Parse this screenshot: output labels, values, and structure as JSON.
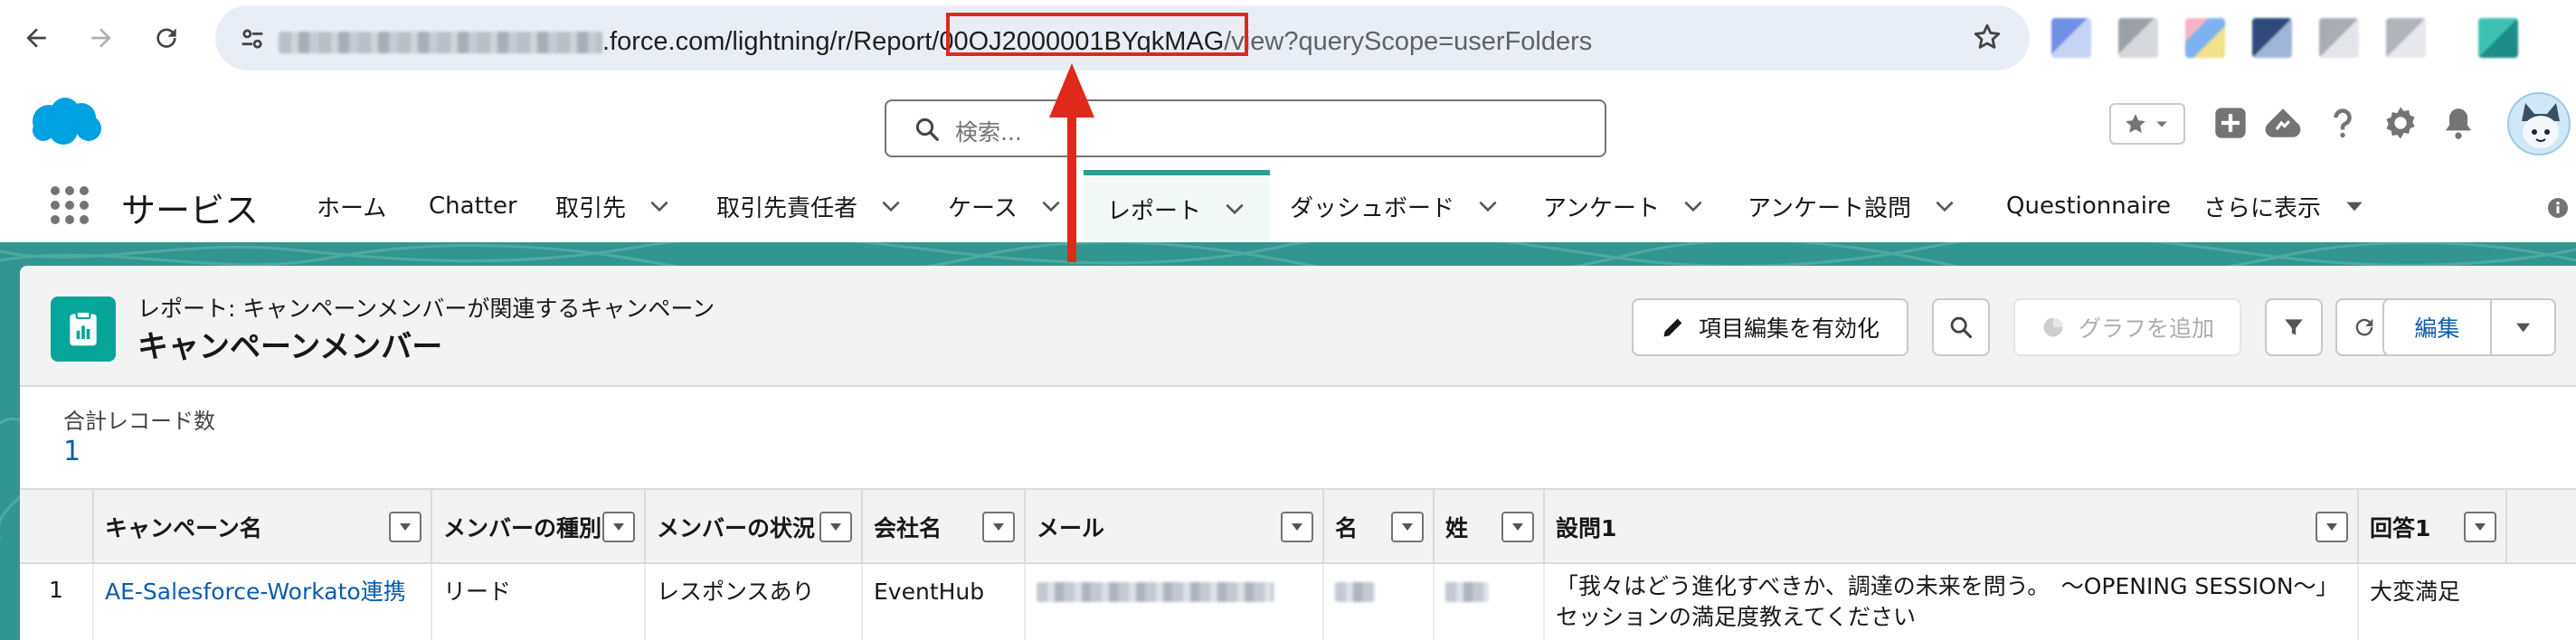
{
  "browser": {
    "url_visible": ".force.com/lightning/r/Report/",
    "url_id": "00OJ2000001BYqkMAG",
    "url_rest": "/view?queryScope=userFolders",
    "icons": [
      "back-icon",
      "forward-icon",
      "reload-icon",
      "site-settings-icon",
      "bookmark-star-icon"
    ]
  },
  "header": {
    "search_placeholder": "検索..."
  },
  "nav": {
    "app_name": "サービス",
    "items": [
      {
        "label": "ホーム"
      },
      {
        "label": "Chatter"
      },
      {
        "label": "取引先"
      },
      {
        "label": "取引先責任者"
      },
      {
        "label": "ケース"
      },
      {
        "label": "レポート"
      },
      {
        "label": "ダッシュボード"
      },
      {
        "label": "アンケート"
      },
      {
        "label": "アンケート設問"
      },
      {
        "label": "Questionnaire"
      },
      {
        "label": "さらに表示"
      }
    ]
  },
  "report": {
    "subtitle": "レポート: キャンペーンメンバーが関連するキャンペーン",
    "title": "キャンペーンメンバー",
    "buttons": {
      "edit_enable": "項目編集を有効化",
      "add_chart": "グラフを追加",
      "edit": "編集"
    },
    "total_label": "合計レコード数",
    "total_value": "1"
  },
  "table": {
    "columns": [
      "キャンペーン名",
      "メンバーの種別",
      "メンバーの状況",
      "会社名",
      "メール",
      "名",
      "姓",
      "設問1",
      "回答1"
    ],
    "rows": [
      {
        "num": "1",
        "campaign": "AE-Salesforce-Workato連携",
        "member_type": "リード",
        "member_status": "レスポンスあり",
        "company": "EventHub",
        "question_line1": "「我々はどう進化すべきか、調達の未来を問う。　〜OPENING SESSION〜」",
        "question_line2": "セッションの満足度教えてください",
        "answer": "大変満足"
      }
    ]
  },
  "colors": {
    "brand_teal": "#06a59a",
    "banner": "#32958f",
    "link": "#0b5cab",
    "highlight_red": "#e0281b",
    "salesforce_cloud": "#00a1e0"
  }
}
